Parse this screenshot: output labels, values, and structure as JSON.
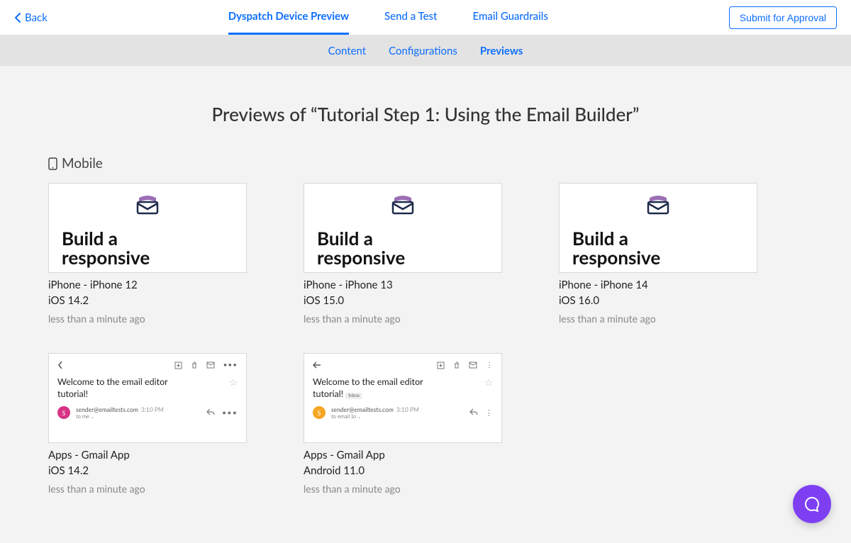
{
  "topbar": {
    "back_label": "Back",
    "tabs": [
      {
        "label": "Dyspatch Device Preview",
        "active": true
      },
      {
        "label": "Send a Test",
        "active": false
      },
      {
        "label": "Email Guardrails",
        "active": false
      }
    ],
    "submit_label": "Submit for Approval"
  },
  "subtabs": [
    {
      "label": "Content",
      "active": false
    },
    {
      "label": "Configurations",
      "active": false
    },
    {
      "label": "Previews",
      "active": true
    }
  ],
  "page_title": "Previews of “Tutorial Step 1: Using the Email Builder”",
  "section_label": "Mobile",
  "email_preview_headline": "Build a\nresponsive",
  "previewsRow1": [
    {
      "device": "iPhone - iPhone 12",
      "os": "iOS 14.2",
      "time": "less than a minute ago"
    },
    {
      "device": "iPhone - iPhone 13",
      "os": "iOS 15.0",
      "time": "less than a minute ago"
    },
    {
      "device": "iPhone - iPhone 14",
      "os": "iOS 16.0",
      "time": "less than a minute ago"
    }
  ],
  "gmail": {
    "subject": "Welcome to the email editor tutorial!",
    "sender": "sender@emailtests.com",
    "sent_time": "3:10 PM",
    "to_line": "to me",
    "to_line_android": "to email to",
    "inbox_label": "Inbox",
    "avatar_initial": "S"
  },
  "previewsRow2": [
    {
      "device": "Apps - Gmail App",
      "os": "iOS 14.2",
      "time": "less than a minute ago"
    },
    {
      "device": "Apps - Gmail App",
      "os": "Android 11.0",
      "time": "less than a minute ago"
    }
  ]
}
